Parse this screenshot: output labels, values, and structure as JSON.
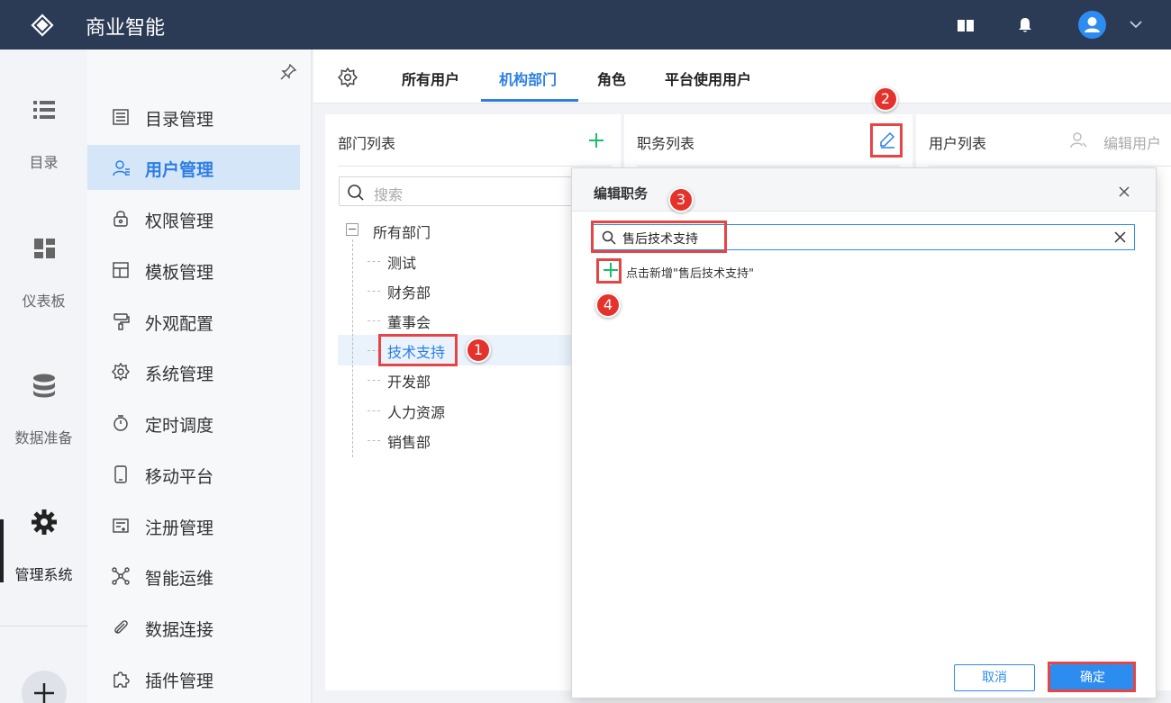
{
  "header": {
    "app_title": "商业智能"
  },
  "rail": {
    "items": [
      {
        "label": "目录",
        "icon": "list-icon"
      },
      {
        "label": "仪表板",
        "icon": "dashboard-icon"
      },
      {
        "label": "数据准备",
        "icon": "database-icon"
      },
      {
        "label": "管理系统",
        "icon": "gear-icon"
      }
    ],
    "add_label": "+"
  },
  "menu": {
    "items": [
      {
        "label": "目录管理",
        "icon": "catalog-icon"
      },
      {
        "label": "用户管理",
        "icon": "user-icon",
        "active": true
      },
      {
        "label": "权限管理",
        "icon": "lock-icon"
      },
      {
        "label": "模板管理",
        "icon": "template-icon"
      },
      {
        "label": "外观配置",
        "icon": "paint-icon"
      },
      {
        "label": "系统管理",
        "icon": "gear-icon"
      },
      {
        "label": "定时调度",
        "icon": "timer-icon"
      },
      {
        "label": "移动平台",
        "icon": "mobile-icon"
      },
      {
        "label": "注册管理",
        "icon": "register-icon"
      },
      {
        "label": "智能运维",
        "icon": "ops-icon"
      },
      {
        "label": "数据连接",
        "icon": "paperclip-icon"
      },
      {
        "label": "插件管理",
        "icon": "plugin-icon"
      }
    ]
  },
  "tabs": {
    "items": [
      "所有用户",
      "机构部门",
      "角色",
      "平台使用用户"
    ],
    "active": "机构部门"
  },
  "dept_panel": {
    "title": "部门列表",
    "search_placeholder": "搜索",
    "tree_root": "所有部门",
    "tree_children": [
      "测试",
      "财务部",
      "董事会",
      "技术支持",
      "开发部",
      "人力资源",
      "销售部"
    ]
  },
  "position_panel": {
    "title": "职务列表"
  },
  "user_panel": {
    "title": "用户列表",
    "edit_label": "编辑用户"
  },
  "dialog": {
    "title": "编辑职务",
    "search_value": "售后技术支持",
    "add_text": "点击新增\"售后技术支持\"",
    "cancel_label": "取消",
    "ok_label": "确定"
  },
  "callouts": [
    "1",
    "2",
    "3",
    "4"
  ],
  "colors": {
    "topbar": "#2c3b55",
    "accent": "#2d7fe3",
    "highlight": "#e64545",
    "add_green": "#19be6b"
  }
}
